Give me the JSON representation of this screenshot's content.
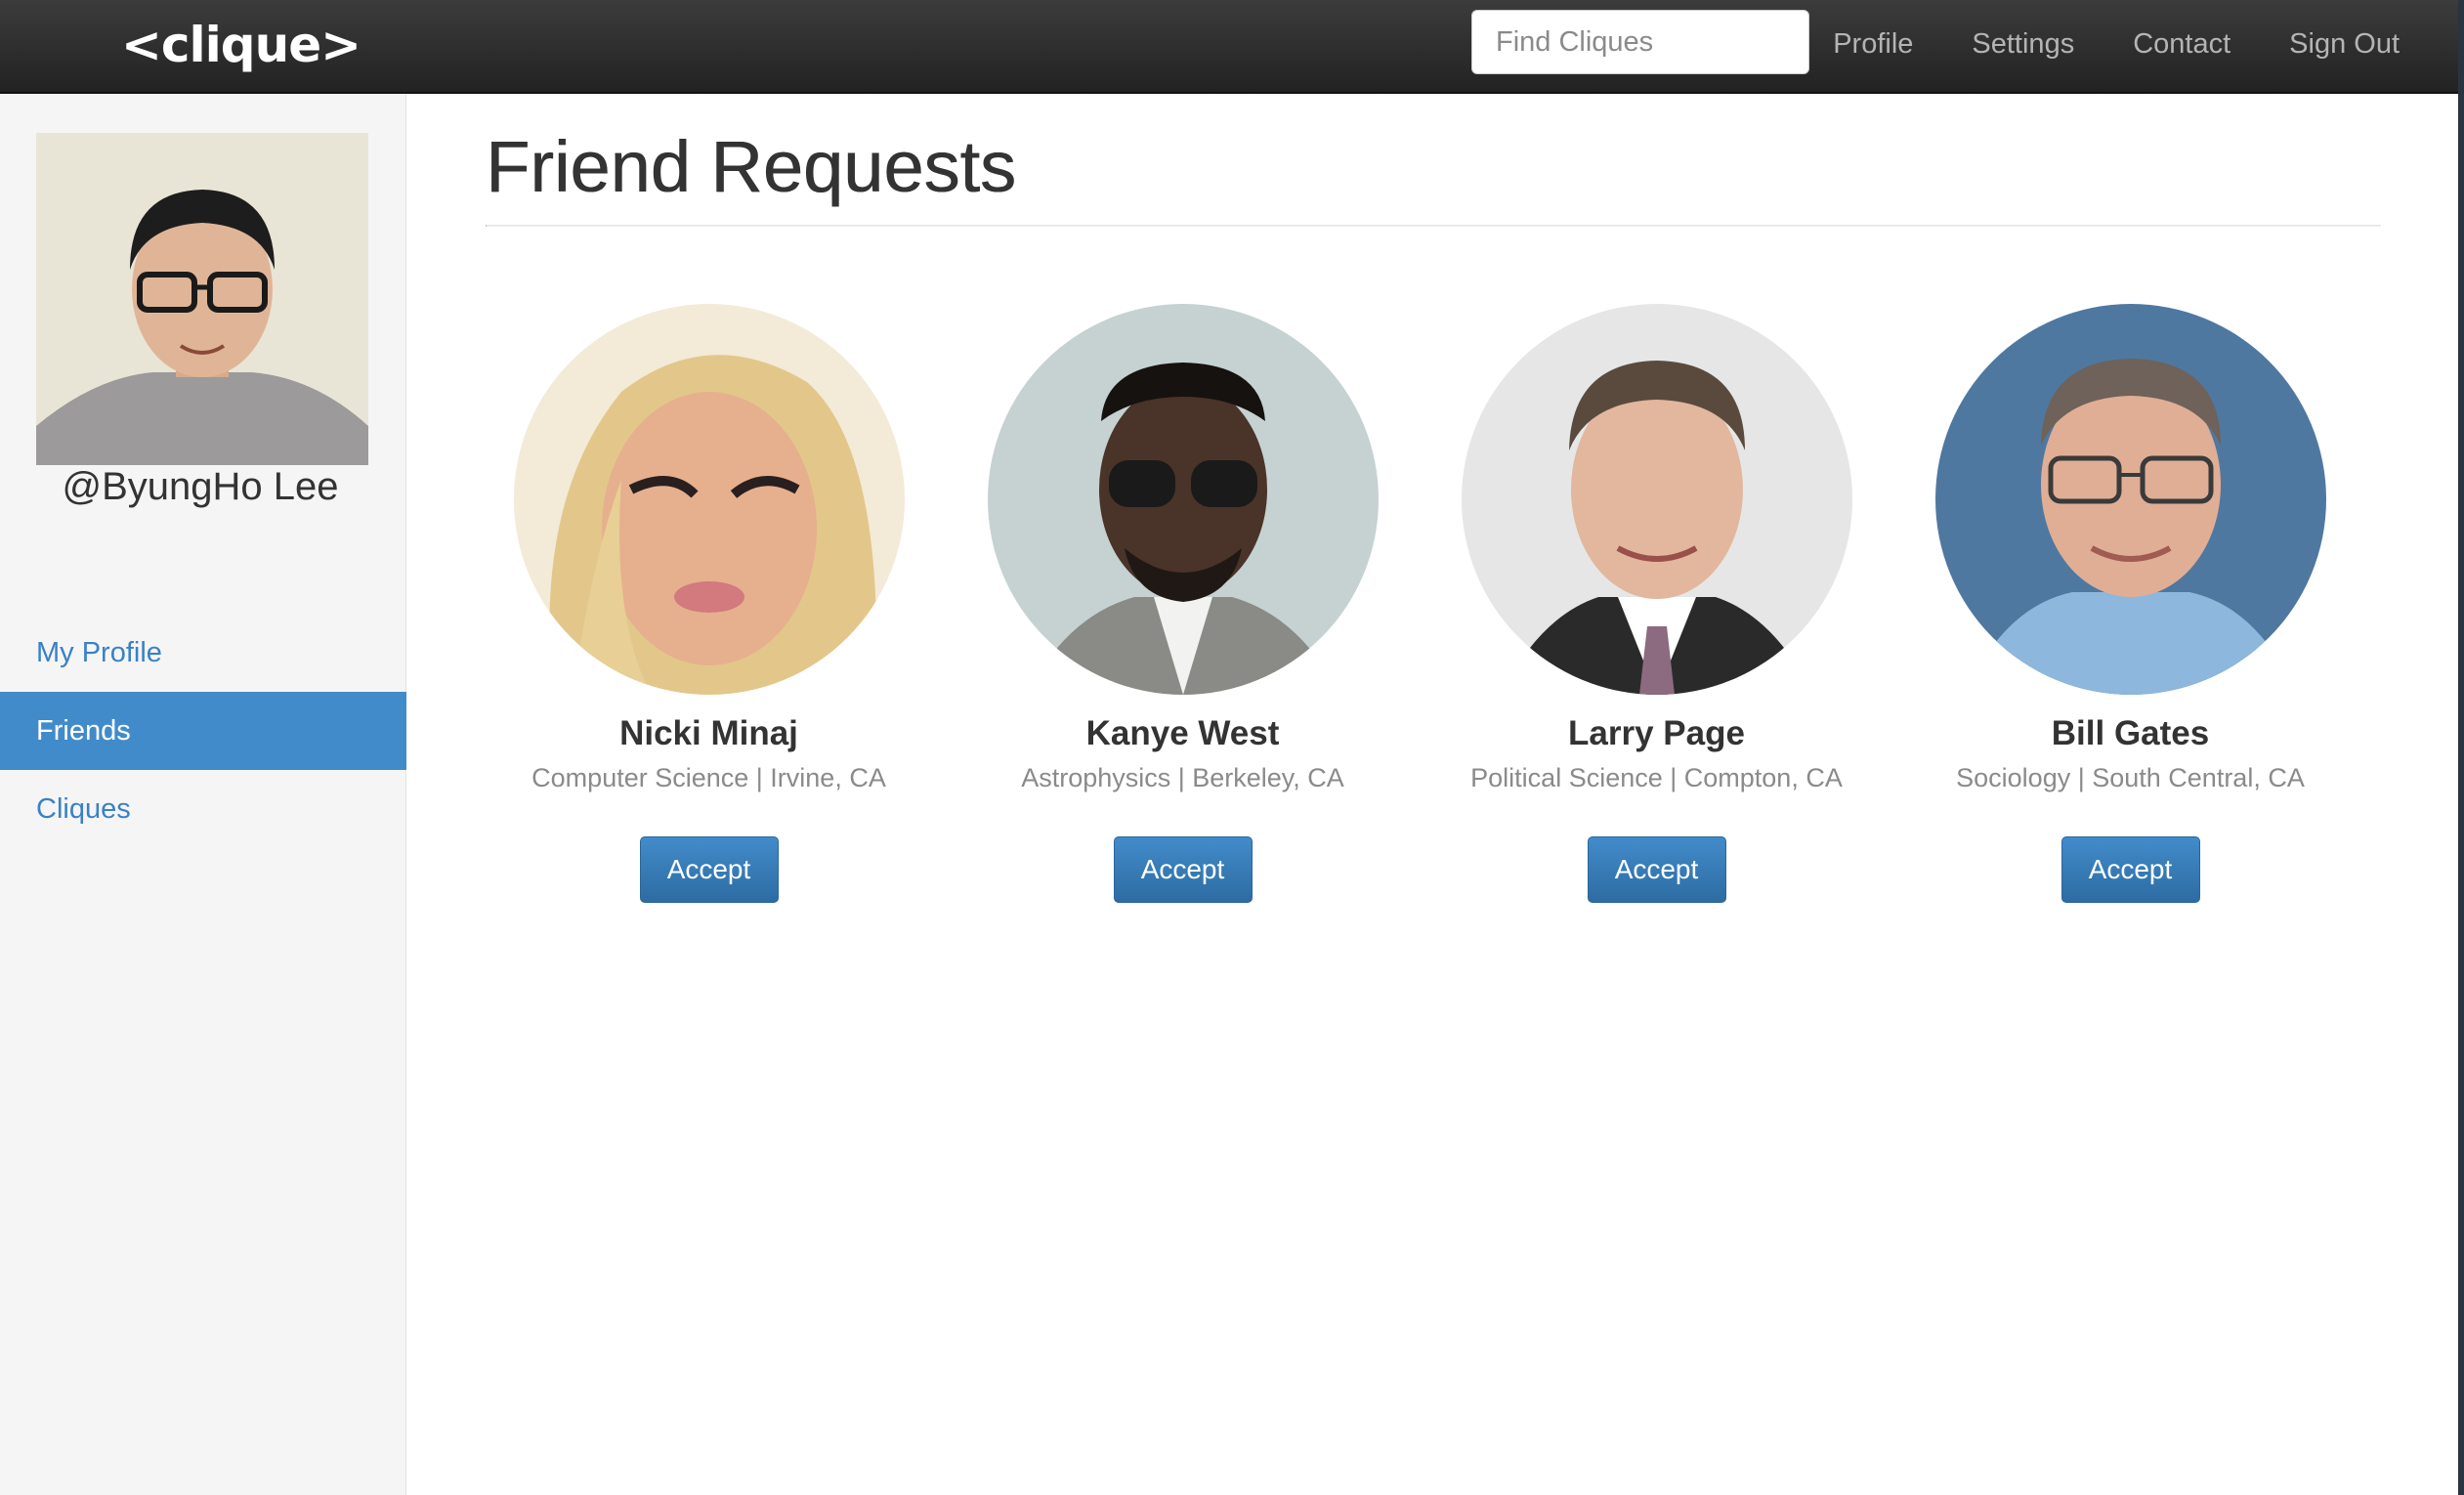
{
  "brand": "<clique>",
  "nav": {
    "search_placeholder": "Find Cliques",
    "links": [
      "Profile",
      "Settings",
      "Contact",
      "Sign Out"
    ]
  },
  "sidebar": {
    "username": "@ByungHo Lee",
    "items": [
      {
        "label": "My Profile",
        "active": false
      },
      {
        "label": "Friends",
        "active": true
      },
      {
        "label": "Cliques",
        "active": false
      }
    ]
  },
  "main": {
    "title": "Friend Requests",
    "requests": [
      {
        "name": "Nicki Minaj",
        "subtitle": "Computer Science | Irvine, CA",
        "action": "Accept"
      },
      {
        "name": "Kanye West",
        "subtitle": "Astrophysics | Berkeley, CA",
        "action": "Accept"
      },
      {
        "name": "Larry Page",
        "subtitle": "Political Science | Compton, CA",
        "action": "Accept"
      },
      {
        "name": "Bill Gates",
        "subtitle": "Sociology | South Central, CA",
        "action": "Accept"
      }
    ]
  },
  "colors": {
    "navbar": "#222222",
    "link": "#3a81c6",
    "active": "#428bca",
    "button": "#337ab7"
  }
}
